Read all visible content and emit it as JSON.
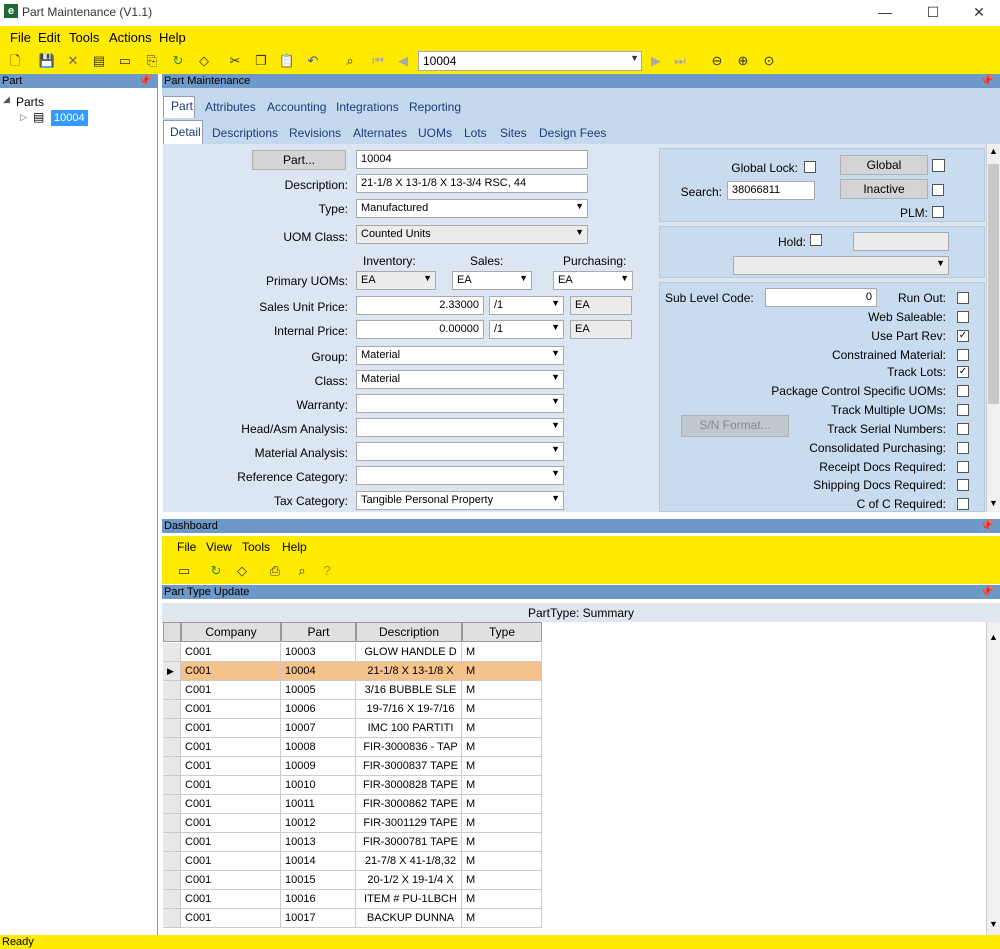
{
  "window": {
    "title": "Part Maintenance (V1.1)",
    "min": "—",
    "max": "☐",
    "close": "✕"
  },
  "menu": [
    "File",
    "Edit",
    "Tools",
    "Actions",
    "Help"
  ],
  "toolbar": {
    "search_value": "10004"
  },
  "left": {
    "header": "Part",
    "tree_root": "Parts",
    "tree_node": "10004"
  },
  "main_header": "Part Maintenance",
  "tabs1": [
    "Part",
    "Attributes",
    "Accounting",
    "Integrations",
    "Reporting"
  ],
  "tabs2": [
    "Detail",
    "Descriptions",
    "Revisions",
    "Alternates",
    "UOMs",
    "Lots",
    "Sites",
    "Design Fees"
  ],
  "form": {
    "part_btn": "Part...",
    "part_value": "10004",
    "desc_label": "Description:",
    "desc_value": "21-1/8 X 13-1/8 X 13-3/4 RSC, 44",
    "type_label": "Type:",
    "type_value": "Manufactured",
    "uom_class_label": "UOM Class:",
    "uom_class_value": "Counted Units",
    "inv_hdr": "Inventory:",
    "sales_hdr": "Sales:",
    "purch_hdr": "Purchasing:",
    "primary_uoms_label": "Primary UOMs:",
    "inv_uom": "EA",
    "sales_uom": "EA",
    "purch_uom": "EA",
    "sales_price_label": "Sales Unit Price:",
    "sales_price": "2.33000",
    "sales_per": "/1",
    "sales_price_uom": "EA",
    "internal_price_label": "Internal Price:",
    "internal_price": "0.00000",
    "internal_per": "/1",
    "internal_price_uom": "EA",
    "group_label": "Group:",
    "group_value": "Material",
    "class_label": "Class:",
    "class_value": "Material",
    "warranty_label": "Warranty:",
    "warranty_value": "",
    "head_label": "Head/Asm Analysis:",
    "head_value": "",
    "mat_label": "Material Analysis:",
    "mat_value": "",
    "ref_label": "Reference Category:",
    "ref_value": "",
    "tax_label": "Tax Category:",
    "tax_value": "Tangible Personal Property",
    "global_lock_label": "Global Lock:",
    "global_btn": "Global",
    "inactive_btn": "Inactive",
    "search_label": "Search:",
    "search_value": "38066811",
    "plm_label": "PLM:",
    "hold_label": "Hold:",
    "sub_level_label": "Sub Level Code:",
    "sub_level_value": "0",
    "sn_btn": "S/N Format...",
    "checks": [
      {
        "label": "Run Out:",
        "checked": false
      },
      {
        "label": "Web Saleable:",
        "checked": false
      },
      {
        "label": "Use Part Rev:",
        "checked": true
      },
      {
        "label": "Constrained Material:",
        "checked": false
      },
      {
        "label": "Track Lots:",
        "checked": true
      },
      {
        "label": "Package Control Specific UOMs:",
        "checked": false
      },
      {
        "label": "Track Multiple UOMs:",
        "checked": false
      },
      {
        "label": "Track Serial Numbers:",
        "checked": false
      },
      {
        "label": "Consolidated Purchasing:",
        "checked": false
      },
      {
        "label": "Receipt Docs Required:",
        "checked": false
      },
      {
        "label": "Shipping Docs Required:",
        "checked": false
      },
      {
        "label": "C of C Required:",
        "checked": false
      }
    ]
  },
  "dashboard": {
    "header": "Dashboard",
    "menu": [
      "File",
      "View",
      "Tools",
      "Help"
    ]
  },
  "ptu": {
    "header": "Part Type Update",
    "summary": "PartType: Summary",
    "columns": [
      "Company",
      "Part",
      "Description",
      "Type"
    ],
    "rows": [
      [
        "C001",
        "10003",
        "GLOW HANDLE D",
        "M"
      ],
      [
        "C001",
        "10004",
        "21-1/8 X 13-1/8 X",
        "M"
      ],
      [
        "C001",
        "10005",
        "3/16 BUBBLE SLE",
        "M"
      ],
      [
        "C001",
        "10006",
        "19-7/16 X 19-7/16",
        "M"
      ],
      [
        "C001",
        "10007",
        "IMC 100 PARTITI",
        "M"
      ],
      [
        "C001",
        "10008",
        "FIR-3000836 - TAP",
        "M"
      ],
      [
        "C001",
        "10009",
        "FIR-3000837 TAPE",
        "M"
      ],
      [
        "C001",
        "10010",
        "FIR-3000828 TAPE",
        "M"
      ],
      [
        "C001",
        "10011",
        "FIR-3000862 TAPE",
        "M"
      ],
      [
        "C001",
        "10012",
        "FIR-3001129 TAPE",
        "M"
      ],
      [
        "C001",
        "10013",
        "FIR-3000781 TAPE",
        "M"
      ],
      [
        "C001",
        "10014",
        "21-7/8 X 41-1/8,32",
        "M"
      ],
      [
        "C001",
        "10015",
        "20-1/2 X 19-1/4 X",
        "M"
      ],
      [
        "C001",
        "10016",
        "ITEM # PU-1LBCH",
        "M"
      ],
      [
        "C001",
        "10017",
        "BACKUP DUNNA",
        "M"
      ]
    ]
  },
  "status": "Ready"
}
